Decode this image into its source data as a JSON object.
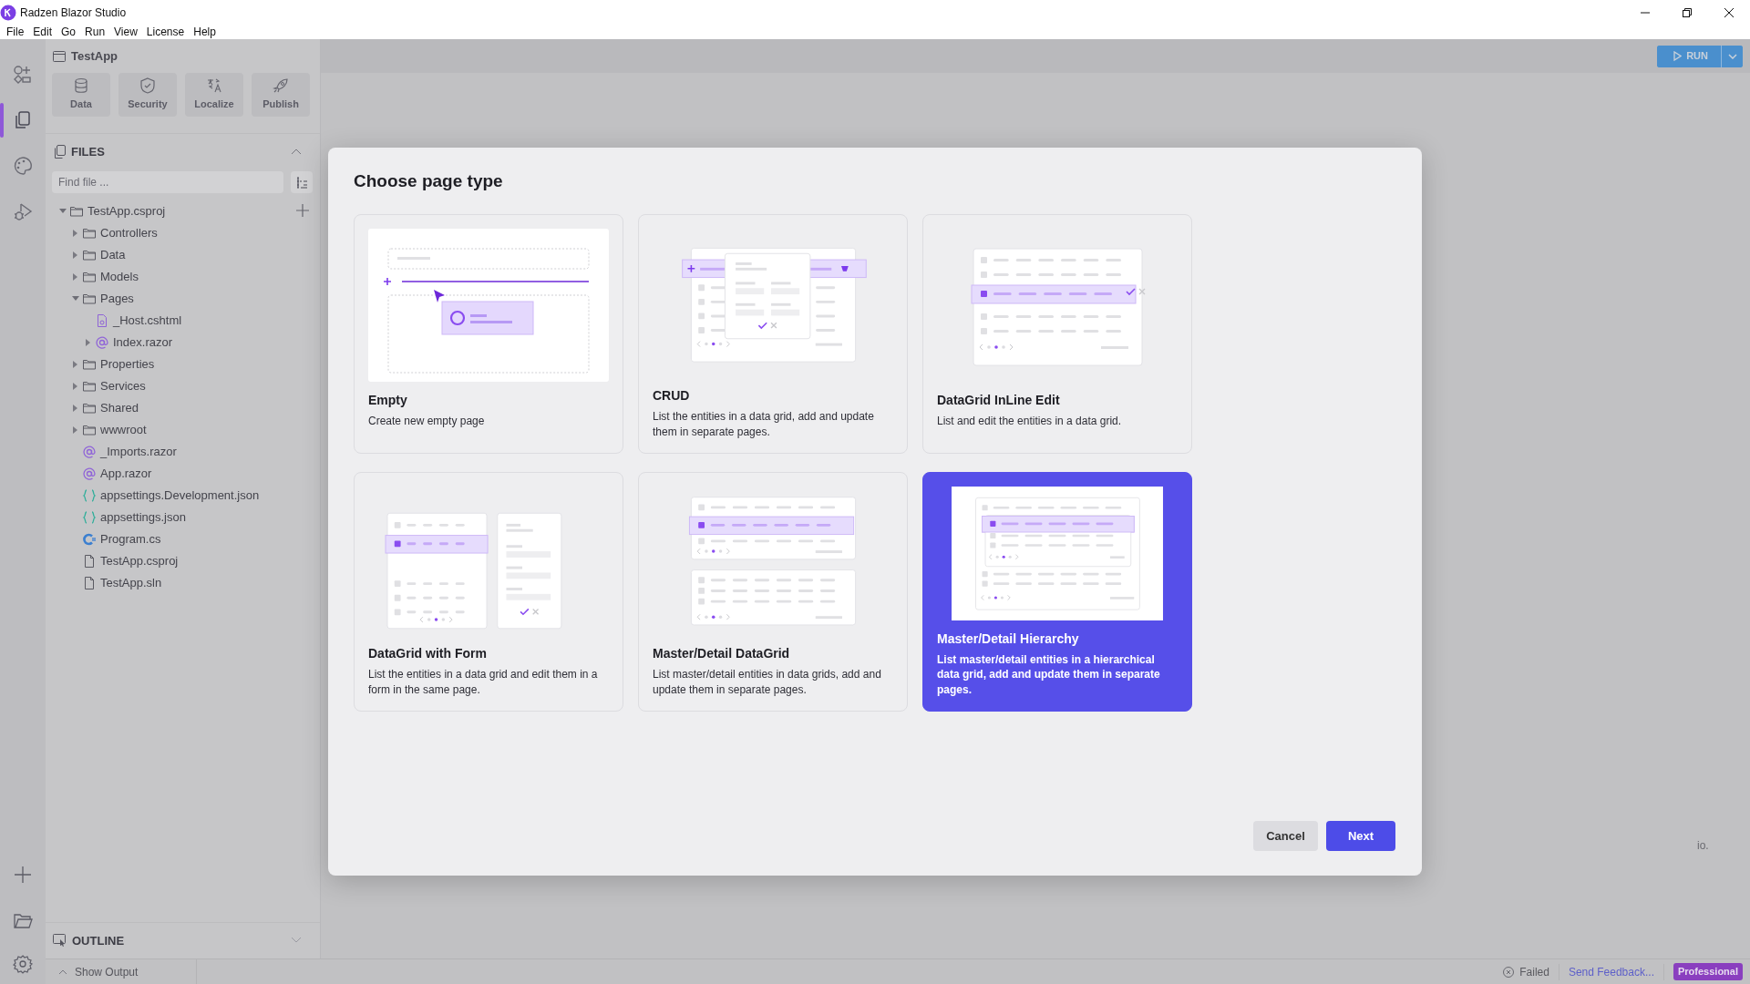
{
  "window": {
    "title": "Radzen Blazor Studio"
  },
  "menu": [
    "File",
    "Edit",
    "Go",
    "Run",
    "View",
    "License",
    "Help"
  ],
  "activity_bar": [
    {
      "kind": "components",
      "selected": false
    },
    {
      "kind": "files",
      "selected": true
    },
    {
      "kind": "theme",
      "selected": false
    },
    {
      "kind": "debug",
      "selected": false
    }
  ],
  "project": {
    "title": "TestApp",
    "tools": [
      "Data",
      "Security",
      "Localize",
      "Publish"
    ]
  },
  "files": {
    "header": "FILES",
    "search": {
      "placeholder": "Find file ..."
    },
    "tree": [
      {
        "label": "TestApp.csproj",
        "kind": "folder",
        "expanded": true,
        "children": [
          {
            "label": "Controllers",
            "kind": "folder",
            "expanded": false
          },
          {
            "label": "Data",
            "kind": "folder",
            "expanded": false
          },
          {
            "label": "Models",
            "kind": "folder",
            "expanded": false
          },
          {
            "label": "Pages",
            "kind": "folder",
            "expanded": true,
            "children": [
              {
                "label": "_Host.cshtml",
                "kind": "page"
              },
              {
                "label": "Index.razor",
                "kind": "razor",
                "expanded": false
              }
            ]
          },
          {
            "label": "Properties",
            "kind": "folder",
            "expanded": false
          },
          {
            "label": "Services",
            "kind": "folder",
            "expanded": false
          },
          {
            "label": "Shared",
            "kind": "folder",
            "expanded": false
          },
          {
            "label": "wwwroot",
            "kind": "folder",
            "expanded": false
          },
          {
            "label": "_Imports.razor",
            "kind": "razor"
          },
          {
            "label": "App.razor",
            "kind": "razor"
          },
          {
            "label": "appsettings.Development.json",
            "kind": "json"
          },
          {
            "label": "appsettings.json",
            "kind": "json"
          },
          {
            "label": "Program.cs",
            "kind": "csharp"
          },
          {
            "label": "TestApp.csproj",
            "kind": "file"
          },
          {
            "label": "TestApp.sln",
            "kind": "file"
          }
        ]
      }
    ]
  },
  "outline": {
    "header": "OUTLINE"
  },
  "toolbar": {
    "run": "RUN"
  },
  "background_text": "io.",
  "dialog": {
    "title": "Choose page type",
    "page_types": [
      {
        "kind": "empty",
        "title": "Empty",
        "description": "Create new empty page",
        "selected": false
      },
      {
        "kind": "crud",
        "title": "CRUD",
        "description": "List the entities in a data grid, add and update them in separate pages.",
        "selected": false
      },
      {
        "kind": "inline",
        "title": "DataGrid InLine Edit",
        "description": "List and edit the entities in a data grid.",
        "selected": false
      },
      {
        "kind": "form",
        "title": "DataGrid with Form",
        "description": "List the entities in a data grid and edit them in a form in the same page.",
        "selected": false
      },
      {
        "kind": "master",
        "title": "Master/Detail DataGrid",
        "description": "List master/detail entities in data grids, add and update them in separate pages.",
        "selected": false
      },
      {
        "kind": "hierarchy",
        "title": "Master/Detail Hierarchy",
        "description": "List master/detail entities in a hierarchical data grid, add and update them in separate pages.",
        "selected": true
      }
    ],
    "buttons": {
      "cancel": "Cancel",
      "next": "Next"
    }
  },
  "status_bar": {
    "output": "Show Output",
    "build": "Failed",
    "feedback": "Send Feedback...",
    "edition": "Professional"
  }
}
